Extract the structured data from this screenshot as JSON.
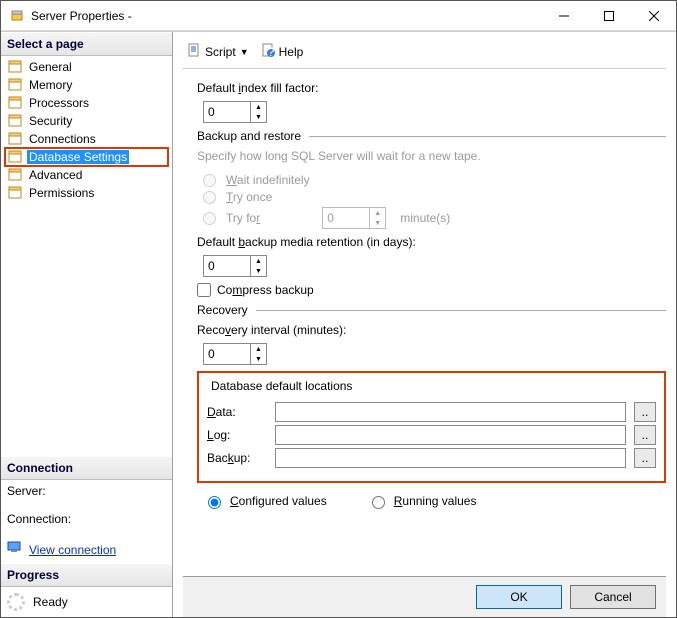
{
  "window": {
    "title": "Server Properties -"
  },
  "sidebar": {
    "select_page": "Select a page",
    "items": [
      {
        "label": "General"
      },
      {
        "label": "Memory"
      },
      {
        "label": "Processors"
      },
      {
        "label": "Security"
      },
      {
        "label": "Connections"
      },
      {
        "label": "Database Settings",
        "selected": true
      },
      {
        "label": "Advanced"
      },
      {
        "label": "Permissions"
      }
    ],
    "connection_head": "Connection",
    "server_label": "Server:",
    "connection_label": "Connection:",
    "view_connection": "View connection ",
    "progress_head": "Progress",
    "ready": "Ready"
  },
  "toolbar": {
    "script": "Script",
    "help": "Help"
  },
  "content": {
    "fill_factor_label": "Default index fill factor:",
    "fill_factor_value": "0",
    "backup_restore": "Backup and restore",
    "hint": "Specify how long SQL Server will wait for a new tape.",
    "wait_indef": "Wait indefinitely",
    "try_once": "Try once",
    "try_for": "Try for",
    "try_for_value": "0",
    "minutes": "minute(s)",
    "retain_label": "Default backup media retention (in days):",
    "retain_value": "0",
    "compress": "Compress backup",
    "recovery": "Recovery",
    "recovery_interval_label": "Recovery interval (minutes):",
    "recovery_interval_value": "0",
    "locations": "Database default locations",
    "data_label": "Data:",
    "log_label": "Log:",
    "backup_label": "Backup:",
    "data_value": "",
    "log_value": "",
    "backup_value": "",
    "browse": "..",
    "configured": "Configured values",
    "running": "Running values"
  },
  "buttons": {
    "ok": "OK",
    "cancel": "Cancel"
  }
}
